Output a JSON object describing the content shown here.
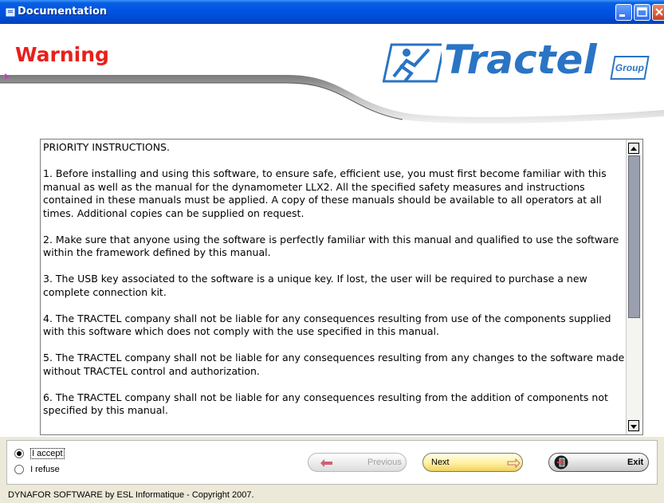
{
  "window": {
    "title": "Documentation",
    "colors": {
      "title_bar": "#0054e3",
      "warning_red": "#e8201c",
      "brand_blue": "#2a74c4",
      "next_yellow": "#fff0a0"
    }
  },
  "header": {
    "heading": "Warning",
    "logo": {
      "brand": "Tractel",
      "group": "Group"
    }
  },
  "document": {
    "paragraphs": [
      "PRIORITY INSTRUCTIONS.",
      "1. Before installing and using this software, to ensure safe, efficient use, you must first become familiar with this manual as well as the manual for the dynamometer LLX2. All the specified safety measures and instructions contained in these manuals must be applied. A copy of these manuals should be available to all operators at all times. Additional copies can be supplied on request.",
      "2. Make sure that anyone using the software is perfectly familiar with this manual and qualified to use the software within the framework defined by this manual.",
      "3. The USB key associated to the software is a unique key. If lost, the user will be required to purchase a new complete connection kit.",
      "4. The TRACTEL company shall not be liable for any consequences resulting from use of the components supplied with this software which does not comply with the use specified in this manual.",
      "5. The TRACTEL company shall not be liable for any consequences resulting from any changes to the software made without TRACTEL control and authorization.",
      "6. The TRACTEL company shall not be liable for any consequences resulting from the addition of components not specified by this manual."
    ]
  },
  "choice": {
    "accept_label": "I accept",
    "refuse_label": "I refuse",
    "selected": "accept"
  },
  "buttons": {
    "previous": "Previous",
    "next": "Next",
    "exit": "Exit"
  },
  "status": {
    "text": "DYNAFOR SOFTWARE by ESL Informatique - Copyright 2007."
  }
}
